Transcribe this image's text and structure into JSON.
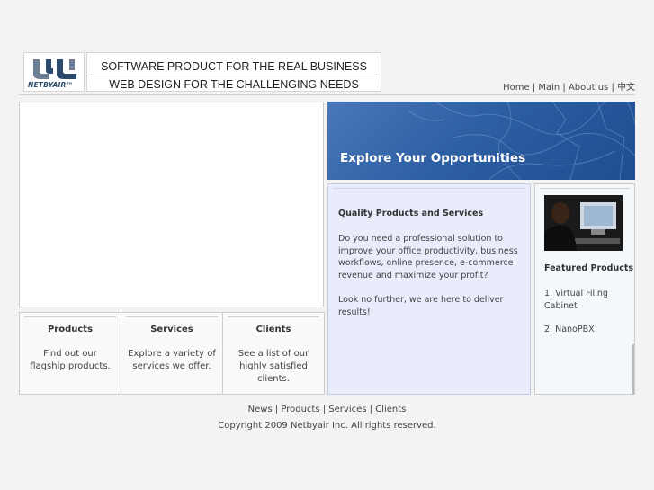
{
  "brand": {
    "logo_text": "NETBYAIR™",
    "tagline_1": "SOFTWARE PRODUCT FOR THE REAL BUSINESS",
    "tagline_2": "WEB DESIGN FOR THE CHALLENGING NEEDS"
  },
  "topnav": {
    "home": "Home",
    "main": "Main",
    "about": "About us",
    "chinese": "中文",
    "sep": " | "
  },
  "hero": {
    "title": "Explore Your Opportunities"
  },
  "columns": [
    {
      "title": "Products",
      "desc": "Find out our flagship products."
    },
    {
      "title": "Services",
      "desc": "Explore a variety of services we offer."
    },
    {
      "title": "Clients",
      "desc": "See a list of our highly satisfied clients."
    }
  ],
  "quality": {
    "title": "Quality Products and Services",
    "body": "Do you need a professional solution to improve your office productivity, business workflows, online presence, e-commerce revenue and maximize your profit?",
    "body2": "Look no further, we are here to deliver results!"
  },
  "featured": {
    "title": "Featured Products",
    "item1": "1. Virtual Filing Cabinet",
    "item2": "2. NanoPBX"
  },
  "footer": {
    "news": "News",
    "products": "Products",
    "services": "Services",
    "clients": "Clients",
    "sep": " | ",
    "copyright": "Copyright 2009 Netbyair Inc. All rights reserved."
  },
  "colors": {
    "hero_blue": "#2d5fa3",
    "panel_lavender": "#e8ecfb",
    "logo_navy": "#2c4a6b"
  }
}
